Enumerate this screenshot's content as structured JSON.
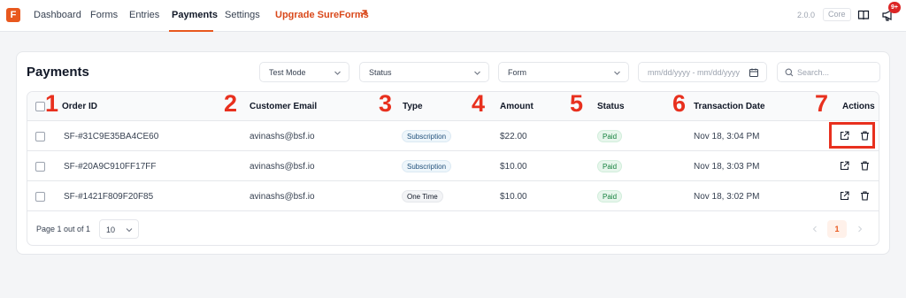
{
  "nav": {
    "logo_letter": "F",
    "items": [
      "Dashboard",
      "Forms",
      "Entries",
      "Payments",
      "Settings"
    ],
    "active": "Payments",
    "upgrade_label": "Upgrade SureForms",
    "version": "2.0.0",
    "plan_badge": "Core",
    "notification_count": "9+"
  },
  "page": {
    "title": "Payments",
    "filters": {
      "mode": "Test Mode",
      "status_placeholder": "Status",
      "form_placeholder": "Form",
      "date_placeholder": "mm/dd/yyyy - mm/dd/yyyy",
      "search_placeholder": "Search..."
    }
  },
  "table": {
    "columns": [
      "Order ID",
      "Customer Email",
      "Type",
      "Amount",
      "Status",
      "Transaction Date",
      "Actions"
    ],
    "rows": [
      {
        "order_id": "SF-#31C9E35BA4CE60",
        "email": "avinashs@bsf.io",
        "type": "Subscription",
        "amount": "$22.00",
        "status": "Paid",
        "date": "Nov 18, 3:04 PM"
      },
      {
        "order_id": "SF-#20A9C910FF17FF",
        "email": "avinashs@bsf.io",
        "type": "Subscription",
        "amount": "$10.00",
        "status": "Paid",
        "date": "Nov 18, 3:03 PM"
      },
      {
        "order_id": "SF-#1421F809F20F85",
        "email": "avinashs@bsf.io",
        "type": "One Time",
        "amount": "$10.00",
        "status": "Paid",
        "date": "Nov 18, 3:02 PM"
      }
    ]
  },
  "pagination": {
    "page_info": "Page 1 out of 1",
    "per_page": "10",
    "current_page": "1"
  },
  "annotations": {
    "markers": [
      "1",
      "2",
      "3",
      "4",
      "5",
      "6",
      "7"
    ],
    "highlight_color": "#e8301e"
  },
  "colors": {
    "brand": "#e8581e",
    "paid_text": "#15803d"
  }
}
